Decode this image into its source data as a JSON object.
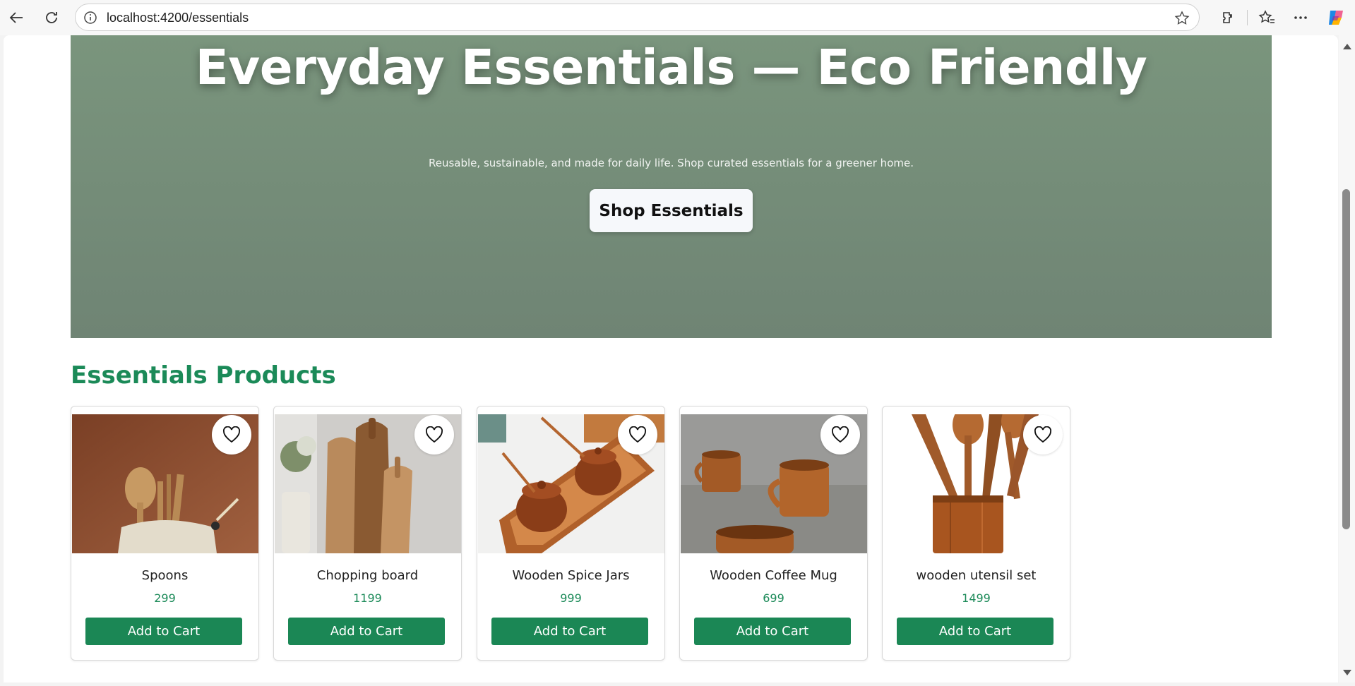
{
  "browser": {
    "url": "localhost:4200/essentials"
  },
  "hero": {
    "title": "Everyday Essentials — Eco Friendly",
    "subtitle": "Reusable, sustainable, and made for daily life. Shop curated essentials for a greener home.",
    "cta_label": "Shop Essentials"
  },
  "section": {
    "title": "Essentials Products"
  },
  "products": [
    {
      "name": "Spoons",
      "price": "299",
      "button_label": "Add to Cart"
    },
    {
      "name": "Chopping board",
      "price": "1199",
      "button_label": "Add to Cart"
    },
    {
      "name": "Wooden Spice Jars",
      "price": "999",
      "button_label": "Add to Cart"
    },
    {
      "name": "Wooden Coffee Mug",
      "price": "699",
      "button_label": "Add to Cart"
    },
    {
      "name": "wooden utensil set",
      "price": "1499",
      "button_label": "Add to Cart"
    }
  ],
  "colors": {
    "accent": "#1b8a58",
    "hero_bg": "#748d78"
  },
  "icons": [
    "back-arrow-icon",
    "refresh-icon",
    "info-icon",
    "star-icon",
    "extensions-icon",
    "favorites-icon",
    "more-icon",
    "copilot-icon",
    "heart-icon"
  ]
}
